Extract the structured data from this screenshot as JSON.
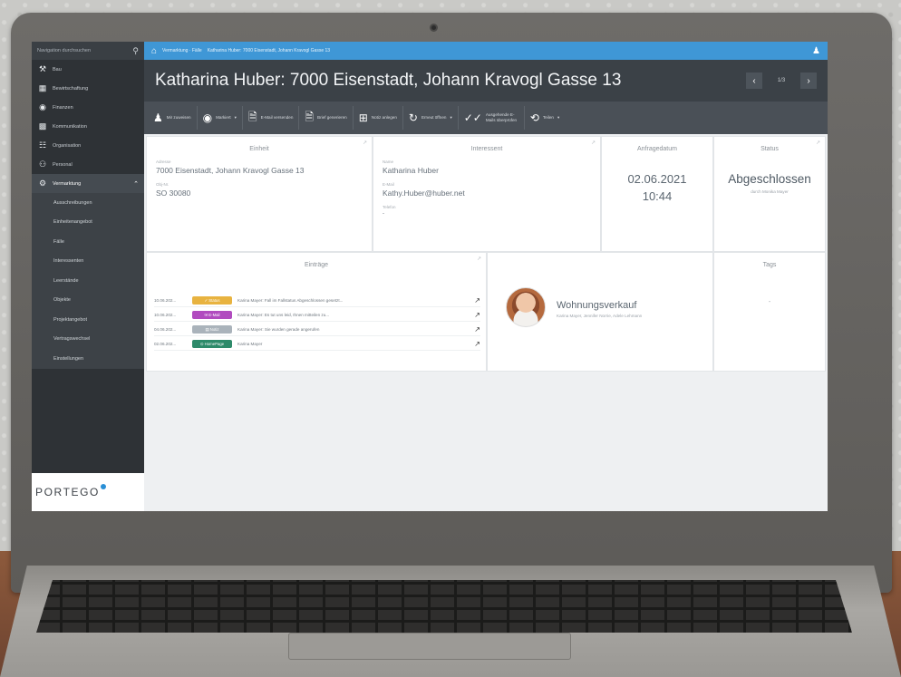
{
  "sidebar": {
    "search_placeholder": "Navigation durchsuchen",
    "items": [
      {
        "label": "Bau",
        "icon": "crane-icon"
      },
      {
        "label": "Bewirtschaftung",
        "icon": "building-icon"
      },
      {
        "label": "Finanzen",
        "icon": "coins-icon"
      },
      {
        "label": "Kommunikation",
        "icon": "chat-icon"
      },
      {
        "label": "Organisation",
        "icon": "org-chart-icon"
      },
      {
        "label": "Personal",
        "icon": "people-icon"
      },
      {
        "label": "Vermarktung",
        "icon": "handshake-icon"
      }
    ],
    "sub_items": [
      "Ausschreibungen",
      "Einheitenangebot",
      "Fälle",
      "Interessenten",
      "Leerstände",
      "Objekte",
      "Projektangebot",
      "Vertragswechsel",
      "Einstellungen"
    ],
    "logo_text": "PORTEGO"
  },
  "topbar": {
    "breadcrumb_1": "Vermarktung · Fälle",
    "breadcrumb_2": "Katharina Huber: 7000 Eisenstadt, Johann Kravogl Gasse 13"
  },
  "header": {
    "title": "Katharina Huber: 7000 Eisenstadt, Johann Kravogl Gasse 13",
    "pager_count": "1/3"
  },
  "toolbar": [
    {
      "label": "Mir zuweisen",
      "icon": "person-icon"
    },
    {
      "label": "Markiert",
      "icon": "circle-mark-icon"
    },
    {
      "label": "E-Mail versenden",
      "icon": "document-arrow-icon"
    },
    {
      "label": "Brief generieren",
      "icon": "letter-icon"
    },
    {
      "label": "Notiz anlegen",
      "icon": "note-plus-icon"
    },
    {
      "label": "Erneut öffnen",
      "icon": "refresh-icon"
    },
    {
      "label": "Ausgehende E-Mails überprüfen",
      "icon": "double-check-icon"
    },
    {
      "label": "Teilen",
      "icon": "share-icon"
    }
  ],
  "einheit": {
    "head": "Einheit",
    "adresse_label": "Adresse",
    "adresse": "7000 Eisenstadt, Johann Kravogl Gasse 13",
    "objnr_label": "Obj-Nr.",
    "objnr": "SO 30080"
  },
  "interessent": {
    "head": "Interessent",
    "name_label": "Name",
    "name": "Katharina Huber",
    "email_label": "E-Mail",
    "email": "Kathy.Huber@huber.net",
    "phone_label": "Telefon",
    "phone": "-"
  },
  "anfrage": {
    "head": "Anfragedatum",
    "date": "02.06.2021",
    "time": "10:44"
  },
  "status": {
    "head": "Status",
    "value": "Abgeschlossen",
    "by": "durch Monika Mayer"
  },
  "eintraege": {
    "head": "Einträge",
    "rows": [
      {
        "date": "10.06.202...",
        "badge": "✓ Status",
        "color": "#e8b340",
        "text": "Karina Mayer: Fall im Fallstatus Abgeschlossen gesetzt..."
      },
      {
        "date": "10.06.202...",
        "badge": "✉ E-Mail",
        "color": "#b14bbf",
        "text": "Karina Mayer: Es tut uns leid, Ihnen mitteilen zu..."
      },
      {
        "date": "04.06.202...",
        "badge": "▤ Notiz",
        "color": "#aab3bb",
        "text": "Karina Mayer: Sie wurden gerade angerufen"
      },
      {
        "date": "02.06.202...",
        "badge": "⊙ HomePage",
        "color": "#2e8a6a",
        "text": "Karina Mayer"
      }
    ]
  },
  "wohnung": {
    "title": "Wohnungsverkauf",
    "people": "Karina Mayer, Jennifer Norrie, Adele Lehmann"
  },
  "tags": {
    "head": "Tags",
    "value": "-"
  }
}
